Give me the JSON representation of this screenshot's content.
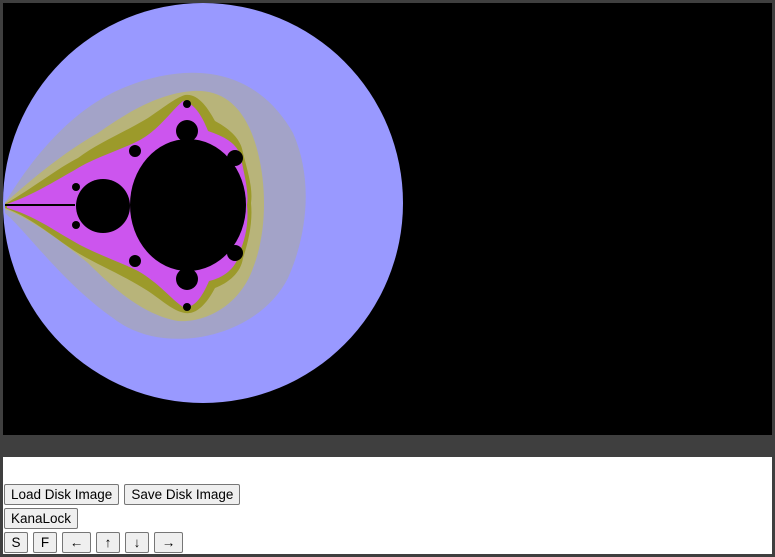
{
  "screen": {
    "content": "mandelbrot-render",
    "colors": {
      "background": "#000000",
      "outer_disk": "#9999ff",
      "inner_disk": "#a3a3c8",
      "band_olive": "#b8b47a",
      "band_olive_dark": "#9c9a2a",
      "fringe_purple": "#cc55ee",
      "set": "#000000"
    }
  },
  "controls": {
    "load_label": "Load Disk Image",
    "save_label": "Save Disk Image",
    "kanalock_label": "KanaLock",
    "s_label": "S",
    "f_label": "F",
    "left_label": "←",
    "up_label": "↑",
    "down_label": "↓",
    "right_label": "→"
  }
}
